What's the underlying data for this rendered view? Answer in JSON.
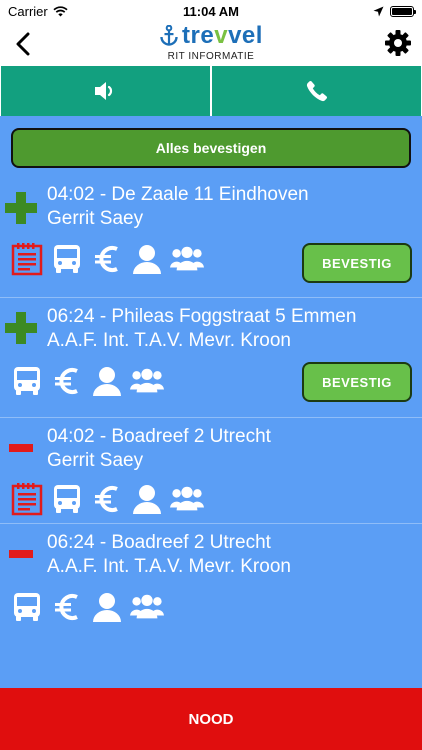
{
  "status_bar": {
    "carrier": "Carrier",
    "time": "11:04 AM"
  },
  "header": {
    "logo_prefix": "tre",
    "logo_v": "v",
    "logo_suffix": "vel",
    "subtitle": "RIT INFORMATIE"
  },
  "colors": {
    "action_green": "#12a07f",
    "content_blue": "#5b9ef5",
    "confirm_green": "#68c04a",
    "nood_red": "#e00e0e",
    "pickup_plus": "#3c8a23",
    "dropoff_minus": "#e11b1b"
  },
  "confirm_all_label": "Alles bevestigen",
  "rides": [
    {
      "kind": "pickup",
      "marker": "plus-icon",
      "line1": "04:02 - De Zaale 11 Eindhoven",
      "line2": "Gerrit Saey",
      "has_note": true,
      "confirm_label": "BEVESTIG"
    },
    {
      "kind": "pickup",
      "marker": "plus-icon",
      "line1": "06:24 - Phileas Foggstraat 5 Emmen",
      "line2": "A.A.F. Int. T.A.V. Mevr. Kroon",
      "has_note": false,
      "confirm_label": "BEVESTIG"
    },
    {
      "kind": "dropoff",
      "marker": "minus-icon",
      "line1": "04:02 - Boadreef 2 Utrecht",
      "line2": "Gerrit Saey",
      "has_note": true
    },
    {
      "kind": "dropoff",
      "marker": "minus-icon",
      "line1": "06:24 - Boadreef 2 Utrecht",
      "line2": "A.A.F. Int. T.A.V. Mevr. Kroon",
      "has_note": false
    }
  ],
  "emergency_label": "NOOD"
}
